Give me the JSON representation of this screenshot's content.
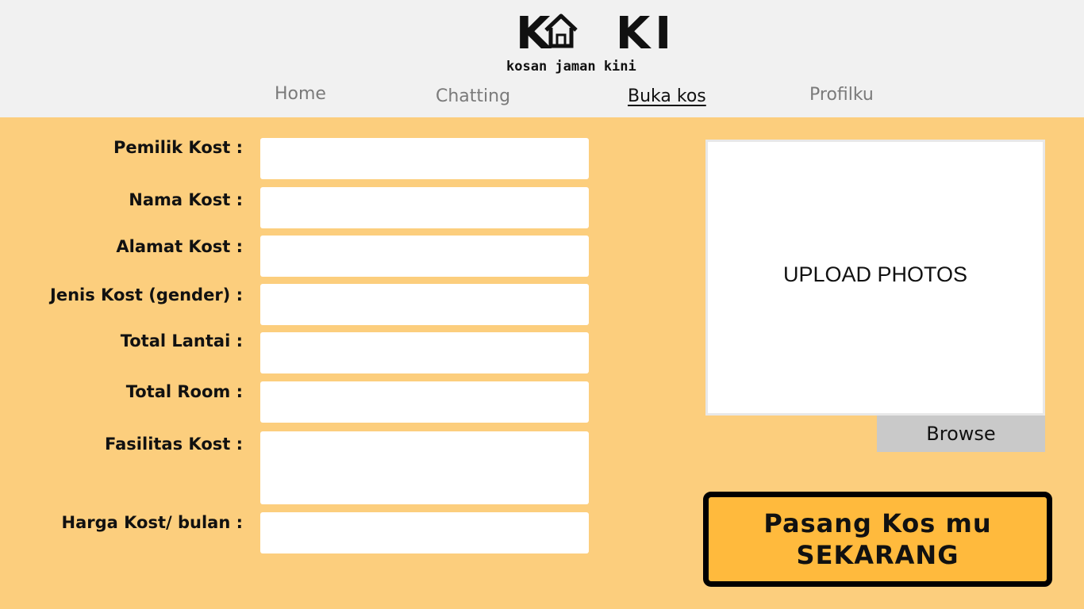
{
  "brand": {
    "name": "KoKI",
    "tagline": "kosan jaman kini"
  },
  "nav": {
    "home": "Home",
    "chatting": "Chatting",
    "buka_kos": "Buka kos",
    "profilku": "Profilku"
  },
  "form": {
    "pemilik": "Pemilik Kost :",
    "nama": "Nama Kost :",
    "alamat": "Alamat Kost :",
    "jenis": "Jenis Kost (gender) :",
    "lantai": "Total Lantai :",
    "room": "Total Room :",
    "fasilitas": "Fasilitas Kost :",
    "harga": "Harga Kost/ bulan :"
  },
  "upload": {
    "label": "UPLOAD PHOTOS",
    "browse": "Browse"
  },
  "cta": {
    "line1": "Pasang Kos mu",
    "line2": "SEKARANG"
  },
  "colors": {
    "background": "#FCCE7D",
    "header": "#F1F1F1",
    "cta": "#FFBA3D",
    "browse": "#C9C9C9"
  }
}
